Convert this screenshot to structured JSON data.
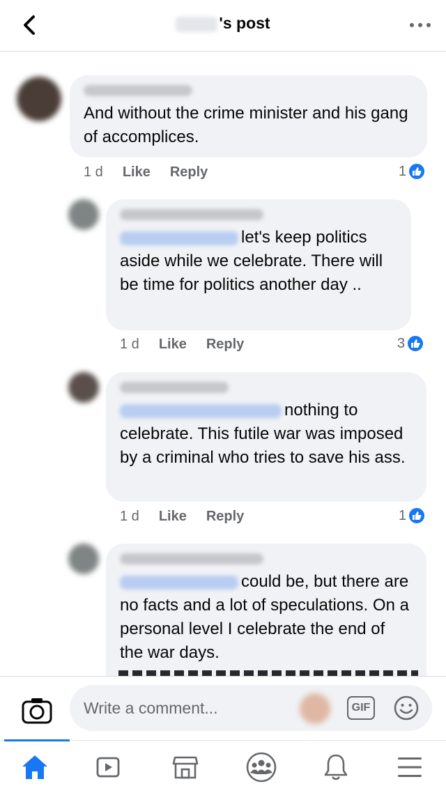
{
  "header": {
    "title_suffix": "'s post",
    "back_icon": "chevron-left-icon",
    "more_icon": "more-horizontal-icon"
  },
  "comments": [
    {
      "text": "And without the crime minister and his gang of accomplices.",
      "time": "1 d",
      "like_label": "Like",
      "reply_label": "Reply",
      "reaction_count": "1"
    },
    {
      "text": "let's keep politics aside while we celebrate. There will be time for politics another day ..",
      "time": "1 d",
      "like_label": "Like",
      "reply_label": "Reply",
      "reaction_count": "3"
    },
    {
      "text": "nothing to celebrate. This futile war was imposed by a criminal who tries to save his ass.",
      "time": "1 d",
      "like_label": "Like",
      "reply_label": "Reply",
      "reaction_count": "1"
    },
    {
      "text": "could be, but there are no facts and a lot of speculations. On a personal level I celebrate the end of the war days."
    }
  ],
  "composer": {
    "placeholder": "Write a comment...",
    "gif_label": "GIF"
  },
  "colors": {
    "accent": "#1877f2",
    "bubble": "#f0f2f5",
    "secondary_text": "#65676b"
  },
  "tabs": [
    {
      "icon": "home-icon",
      "active": true
    },
    {
      "icon": "watch-icon"
    },
    {
      "icon": "marketplace-icon"
    },
    {
      "icon": "groups-icon"
    },
    {
      "icon": "bell-icon"
    },
    {
      "icon": "menu-icon"
    }
  ]
}
